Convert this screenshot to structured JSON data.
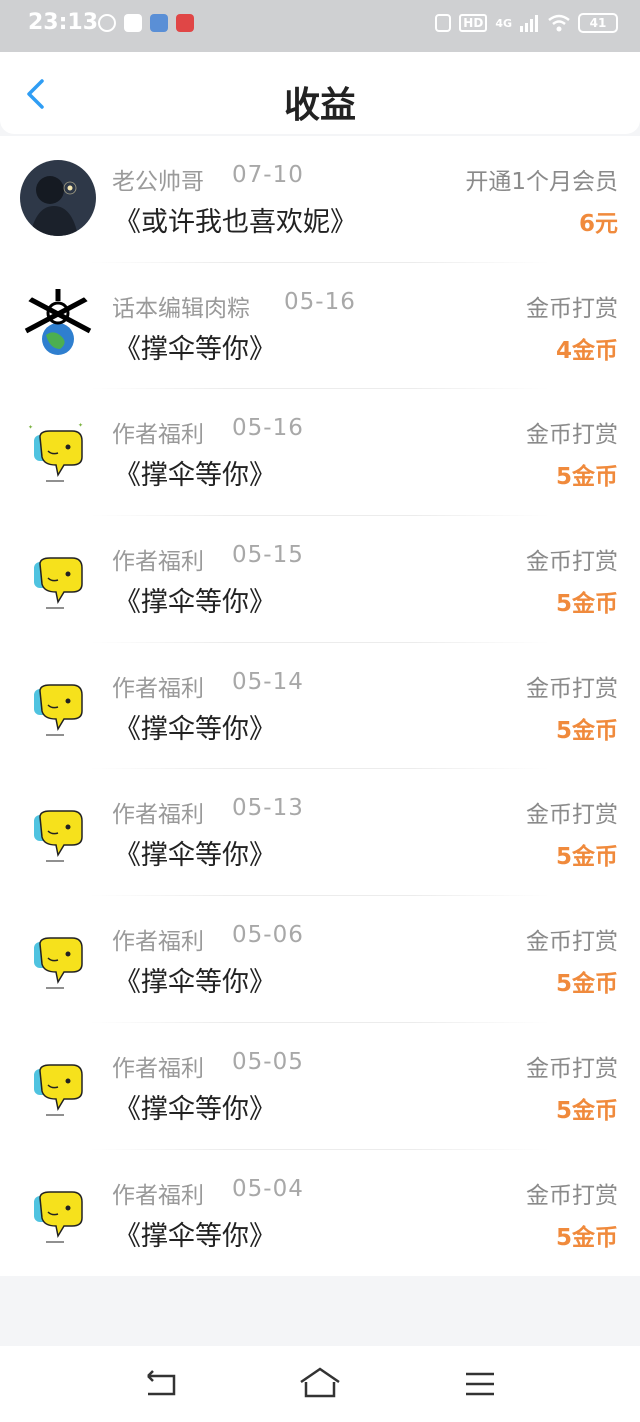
{
  "status_bar": {
    "time": "23:13",
    "battery": "41",
    "network": "4G",
    "hd": "HD"
  },
  "header": {
    "title": "收益",
    "back_icon": "chevron-left-icon"
  },
  "colors": {
    "accent": "#2f9df4",
    "amount": "#f08a3c",
    "status_bar_bg": "#cfd0d2"
  },
  "items": [
    {
      "name": "老公帅哥",
      "date": "07-10",
      "book": "《或许我也喜欢妮》",
      "type": "开通1个月会员",
      "amount": "6元",
      "avatar": "photo"
    },
    {
      "name": "话本编辑肉粽",
      "date": "05-16",
      "book": "《撑伞等你》",
      "type": "金币打赏",
      "amount": "4金币",
      "avatar": "globe"
    },
    {
      "name": "作者福利",
      "date": "05-16",
      "book": "《撑伞等你》",
      "type": "金币打赏",
      "amount": "5金币",
      "avatar": "mascot"
    },
    {
      "name": "作者福利",
      "date": "05-15",
      "book": "《撑伞等你》",
      "type": "金币打赏",
      "amount": "5金币",
      "avatar": "mascot"
    },
    {
      "name": "作者福利",
      "date": "05-14",
      "book": "《撑伞等你》",
      "type": "金币打赏",
      "amount": "5金币",
      "avatar": "mascot"
    },
    {
      "name": "作者福利",
      "date": "05-13",
      "book": "《撑伞等你》",
      "type": "金币打赏",
      "amount": "5金币",
      "avatar": "mascot"
    },
    {
      "name": "作者福利",
      "date": "05-06",
      "book": "《撑伞等你》",
      "type": "金币打赏",
      "amount": "5金币",
      "avatar": "mascot"
    },
    {
      "name": "作者福利",
      "date": "05-05",
      "book": "《撑伞等你》",
      "type": "金币打赏",
      "amount": "5金币",
      "avatar": "mascot"
    },
    {
      "name": "作者福利",
      "date": "05-04",
      "book": "《撑伞等你》",
      "type": "金币打赏",
      "amount": "5金币",
      "avatar": "mascot"
    }
  ],
  "nav_bar": {
    "back_icon": "nav-back-icon",
    "home_icon": "nav-home-icon",
    "menu_icon": "nav-menu-icon"
  }
}
